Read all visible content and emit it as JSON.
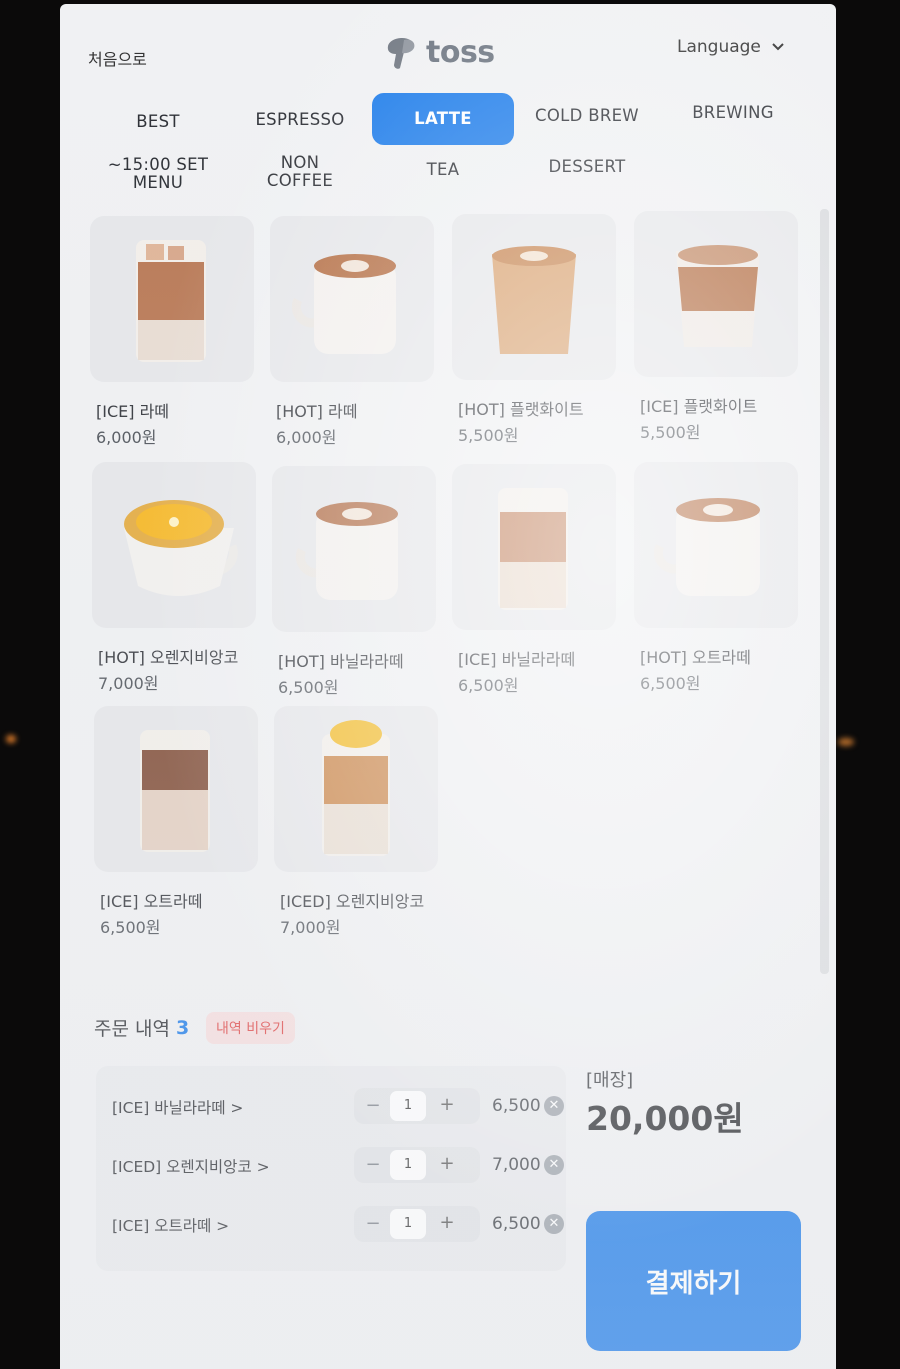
{
  "header": {
    "home_label": "처음으로",
    "logo_text": "toss",
    "language_label": "Language"
  },
  "tabs": [
    {
      "label": "BEST"
    },
    {
      "label": "ESPRESSO"
    },
    {
      "label": "LATTE"
    },
    {
      "label": "COLD BREW"
    },
    {
      "label": "BREWING"
    },
    {
      "label": "~15:00 SET\nMENU"
    },
    {
      "label": "NON\nCOFFEE"
    },
    {
      "label": "TEA"
    },
    {
      "label": "DESSERT"
    }
  ],
  "active_tab": "LATTE",
  "products": [
    {
      "name": "[ICE] 라떼",
      "price": "6,000원"
    },
    {
      "name": "[HOT] 라떼",
      "price": "6,000원"
    },
    {
      "name": "[HOT] 플랫화이트",
      "price": "5,500원"
    },
    {
      "name": "[ICE] 플랫화이트",
      "price": "5,500원"
    },
    {
      "name": "[HOT] 오렌지비앙코",
      "price": "7,000원"
    },
    {
      "name": "[HOT] 바닐라라떼",
      "price": "6,500원"
    },
    {
      "name": "[ICE] 바닐라라떼",
      "price": "6,500원"
    },
    {
      "name": "[HOT] 오트라떼",
      "price": "6,500원"
    },
    {
      "name": "[ICE] 오트라떼",
      "price": "6,500원"
    },
    {
      "name": "[ICED] 오렌지비앙코",
      "price": "7,000원"
    }
  ],
  "order": {
    "title": "주문 내역",
    "count": "3",
    "clear_label": "내역 비우기",
    "items": [
      {
        "name": "[ICE] 바닐라라떼 >",
        "qty": "1",
        "price": "6,500"
      },
      {
        "name": "[ICED] 오렌지비앙코 >",
        "qty": "1",
        "price": "7,000"
      },
      {
        "name": "[ICE] 오트라떼 >",
        "qty": "1",
        "price": "6,500"
      }
    ],
    "minus_symbol": "−",
    "plus_symbol": "+",
    "remove_symbol": "✕"
  },
  "summary": {
    "store_label": "[매장]",
    "total": "20,000원",
    "pay_label": "결제하기"
  },
  "colors": {
    "accent": "#1b7bea",
    "clear_bg": "#f7dede",
    "clear_text": "#e04848"
  }
}
